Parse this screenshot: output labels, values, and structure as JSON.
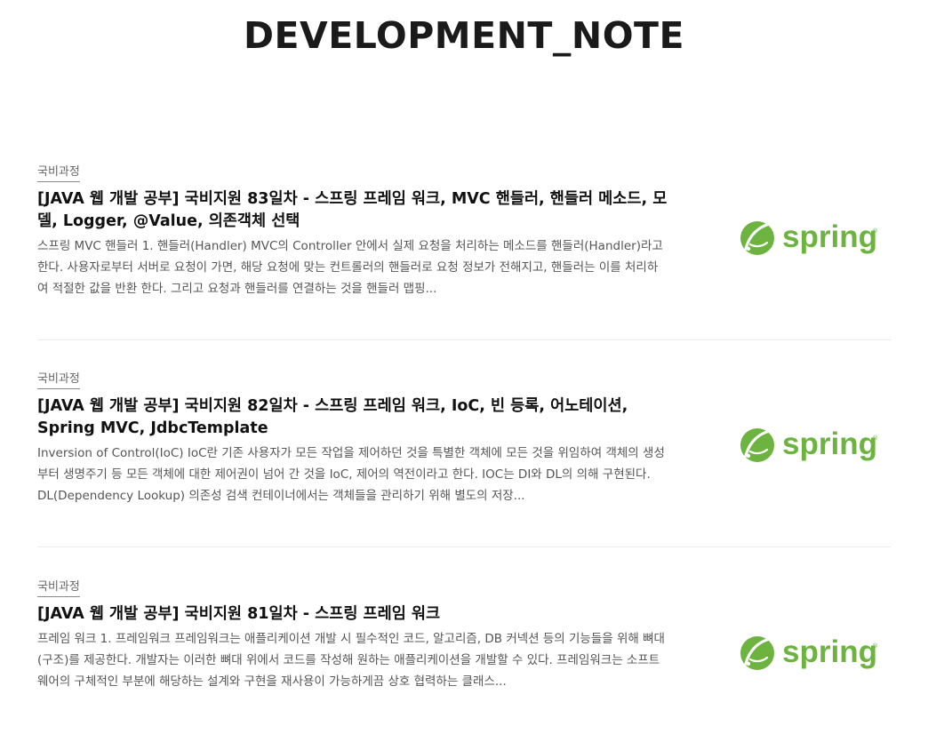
{
  "blog": {
    "title": "DEVELOPMENT_NOTE"
  },
  "logo": {
    "text": "spring",
    "color": "#6db33f",
    "icon": "spring-leaf-icon"
  },
  "posts": [
    {
      "category": "국비과정",
      "title": "[JAVA 웹 개발 공부] 국비지원 83일차 - 스프링 프레임 워크, MVC 핸들러, 핸들러 메소드, 모델, Logger, @Value, 의존객체 선택",
      "excerpt": "스프링 MVC 핸들러 1. 핸들러(Handler) MVC의 Controller 안에서 실제 요청을 처리하는 메소드를 핸들러(Handler)라고 한다. 사용자로부터 서버로 요청이 가면, 해당 요청에 맞는 컨트롤러의 핸들러로 요청 정보가 전해지고, 핸들러는 이를 처리하여 적절한 값을 반환 한다. 그리고 요청과 핸들러를 연결하는 것을 핸들러 맵핑..."
    },
    {
      "category": "국비과정",
      "title": "[JAVA 웹 개발 공부] 국비지원 82일차 - 스프링 프레임 워크, IoC, 빈 등록, 어노테이션, Spring MVC, JdbcTemplate",
      "excerpt": "Inversion of Control(IoC) IoC란 기존 사용자가 모든 작업을 제어하던 것을 특별한 객체에 모든 것을 위임하여 객체의 생성부터 생명주기 등 모든 객체에 대한 제어권이 넘어 간 것을 IoC, 제어의 역전이라고 한다. IOC는 DI와 DL의 의해 구현된다. DL(Dependency Lookup) 의존성 검색 컨테이너에서는 객체들을 관리하기 위해 별도의 저장..."
    },
    {
      "category": "국비과정",
      "title": "[JAVA 웹 개발 공부] 국비지원 81일차 - 스프링 프레임 워크",
      "excerpt": "프레임 워크 1. 프레임워크 프레임워크는 애플리케이션 개발 시 필수적인 코드, 알고리즘, DB 커넥션 등의 기능들을 위해 뼈대(구조)를 제공한다. 개발자는 이러한 뼈대 위에서 코드를 작성해 원하는 애플리케이션을 개발할 수 있다. 프레임워크는 소프트웨어의 구체적인 부분에 해당하는 설계와 구현을 재사용이 가능하게끔 상호 협력하는 클래스..."
    }
  ]
}
